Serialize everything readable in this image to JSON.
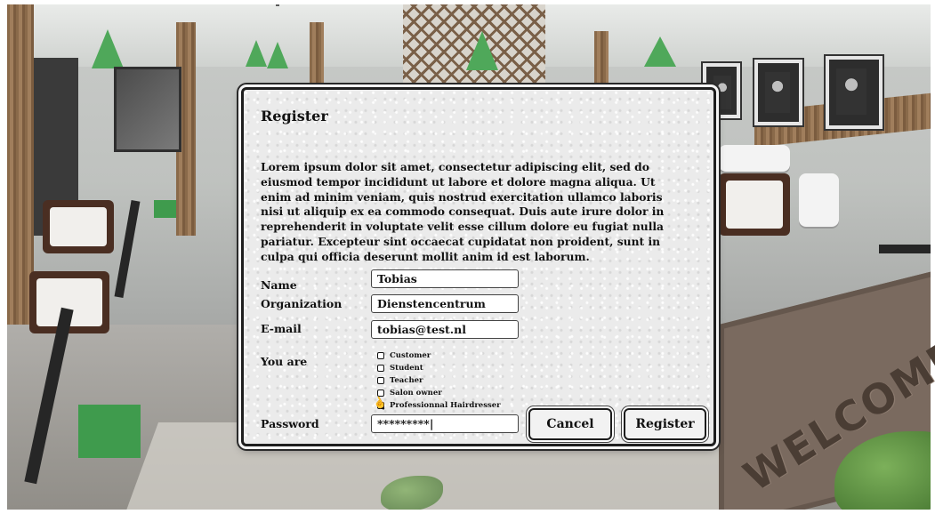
{
  "dialog": {
    "title": "Register",
    "description": "Lorem ipsum dolor sit amet, consectetur adipiscing elit, sed do eiusmod tempor incididunt ut labore et dolore magna aliqua. Ut enim ad minim veniam, quis nostrud exercitation ullamco laboris nisi ut aliquip ex ea commodo consequat. Duis aute irure dolor in reprehenderit in voluptate velit esse cillum dolore eu fugiat nulla pariatur. Excepteur sint occaecat cupidatat non proident, sunt in culpa qui officia deserunt mollit anim id est laborum.",
    "fields": {
      "name": {
        "label": "Name",
        "value": "Tobias"
      },
      "organization": {
        "label": "Organization",
        "value": "Dienstencentrum"
      },
      "email": {
        "label": "E-mail",
        "value": "tobias@test.nl"
      },
      "password": {
        "label": "Password",
        "value": "*********|"
      }
    },
    "you_are": {
      "label": "You are",
      "options": [
        "Customer",
        "Student",
        "Teacher",
        "Salon owner",
        "Professionnal Hairdresser"
      ],
      "selected": "Professionnal Hairdresser"
    },
    "buttons": {
      "cancel": "Cancel",
      "register": "Register"
    }
  },
  "background": {
    "rug_text": "WELCOME"
  },
  "colors": {
    "accent_green": "#4fa85a",
    "dialog_border": "#1e1e1e"
  },
  "icons": {
    "pointer": "hand-pointer-icon"
  }
}
